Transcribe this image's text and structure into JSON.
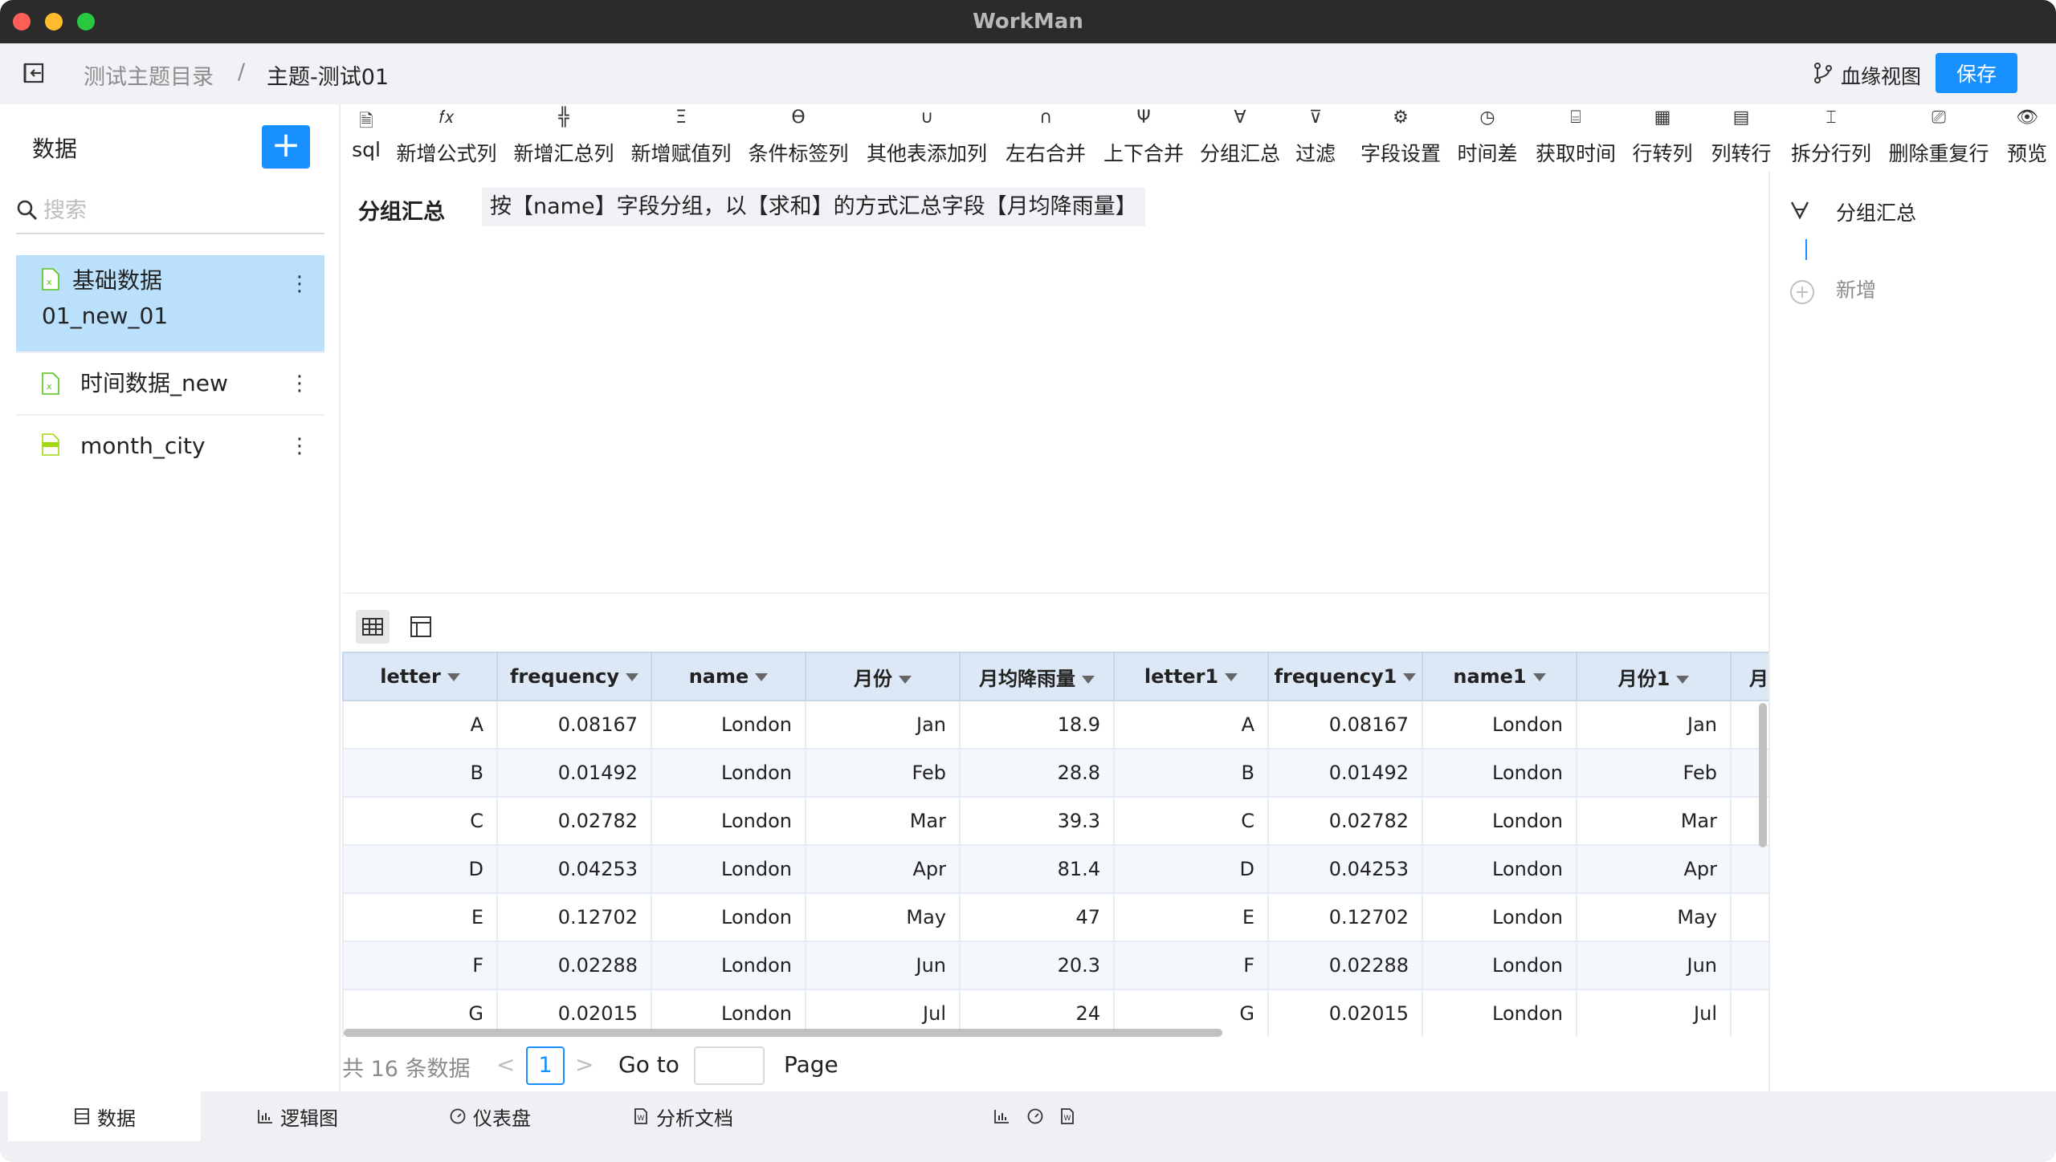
{
  "app": {
    "title": "WorkMan"
  },
  "header": {
    "breadcrumb": [
      "测试主题目录",
      "/",
      "主题-测试01"
    ],
    "lineage_label": "血缘视图",
    "save_label": "保存"
  },
  "sidebar": {
    "title": "数据",
    "add_label": "+",
    "search_placeholder": "搜索",
    "more_glyph": "⋮",
    "datasets": [
      {
        "line1": "基础数据",
        "line2": "01_new_01",
        "icon": "excel-file-icon"
      },
      {
        "line1": "时间数据_new",
        "icon": "excel-file-icon"
      },
      {
        "line1": "month_city",
        "icon": "json-file-icon"
      }
    ]
  },
  "toolbar": [
    {
      "icon": "🗎",
      "label": "sql"
    },
    {
      "icon": "𝑓𝑥",
      "label": "新增公式列"
    },
    {
      "icon": "╬",
      "label": "新增汇总列"
    },
    {
      "icon": "Ξ",
      "label": "新增赋值列"
    },
    {
      "icon": "ϴ",
      "label": "条件标签列"
    },
    {
      "icon": "∪",
      "label": "其他表添加列"
    },
    {
      "icon": "∩",
      "label": "左右合并"
    },
    {
      "icon": "Ψ",
      "label": "上下合并"
    },
    {
      "icon": "∀",
      "label": "分组汇总"
    },
    {
      "icon": "⊽",
      "label": "过滤"
    },
    {
      "icon": "⚙",
      "label": "字段设置"
    },
    {
      "icon": "◷",
      "label": "时间差"
    },
    {
      "icon": "⌸",
      "label": "获取时间"
    },
    {
      "icon": "▦",
      "label": "行转列"
    },
    {
      "icon": "▤",
      "label": "列转行"
    },
    {
      "icon": "⌶",
      "label": "拆分行列"
    },
    {
      "icon": "⎚",
      "label": "删除重复行"
    },
    {
      "icon": "👁",
      "label": "预览"
    }
  ],
  "step": {
    "name": "分组汇总",
    "description": "按【name】字段分组，以【求和】的方式汇总字段【月均降雨量】"
  },
  "right_panel": {
    "step_label": "分组汇总",
    "add_label": "新增"
  },
  "table": {
    "columns": [
      "letter",
      "frequency",
      "name",
      "月份",
      "月均降雨量",
      "letter1",
      "frequency1",
      "name1",
      "月份1",
      "月"
    ],
    "rows": [
      [
        "A",
        "0.08167",
        "London",
        "Jan",
        "18.9",
        "A",
        "0.08167",
        "London",
        "Jan",
        ""
      ],
      [
        "B",
        "0.01492",
        "London",
        "Feb",
        "28.8",
        "B",
        "0.01492",
        "London",
        "Feb",
        ""
      ],
      [
        "C",
        "0.02782",
        "London",
        "Mar",
        "39.3",
        "C",
        "0.02782",
        "London",
        "Mar",
        ""
      ],
      [
        "D",
        "0.04253",
        "London",
        "Apr",
        "81.4",
        "D",
        "0.04253",
        "London",
        "Apr",
        ""
      ],
      [
        "E",
        "0.12702",
        "London",
        "May",
        "47",
        "E",
        "0.12702",
        "London",
        "May",
        ""
      ],
      [
        "F",
        "0.02288",
        "London",
        "Jun",
        "20.3",
        "F",
        "0.02288",
        "London",
        "Jun",
        ""
      ],
      [
        "G",
        "0.02015",
        "London",
        "Jul",
        "24",
        "G",
        "0.02015",
        "London",
        "Jul",
        ""
      ]
    ]
  },
  "pagination": {
    "total": "共 16 条数据",
    "current": "1",
    "goto_label": "Go to",
    "page_label": "Page",
    "prev": "<",
    "next": ">"
  },
  "bottom_tabs": [
    {
      "label": "数据",
      "icon": "data-icon"
    },
    {
      "label": "逻辑图",
      "icon": "chart-icon"
    },
    {
      "label": "仪表盘",
      "icon": "dashboard-icon"
    },
    {
      "label": "分析文档",
      "icon": "document-icon"
    }
  ]
}
